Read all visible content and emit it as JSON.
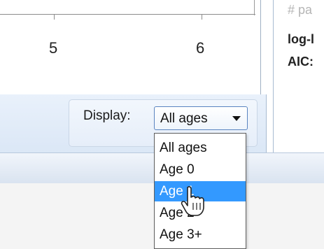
{
  "chart": {
    "tick_labels": [
      "5",
      "6"
    ]
  },
  "stats_panel": {
    "faded_line": "# pa",
    "lines": [
      "log-l",
      "AIC:"
    ]
  },
  "display_control": {
    "label": "Display:",
    "selected_value": "All ages",
    "arrow_icon": "chevron-down-icon",
    "options": [
      "All ages",
      "Age 0",
      "Age 1",
      "Age 2",
      "Age 3+"
    ],
    "highlighted_option": "Age 1"
  },
  "colors": {
    "selection": "#3399ff",
    "combo_border": "#5a84c0"
  }
}
